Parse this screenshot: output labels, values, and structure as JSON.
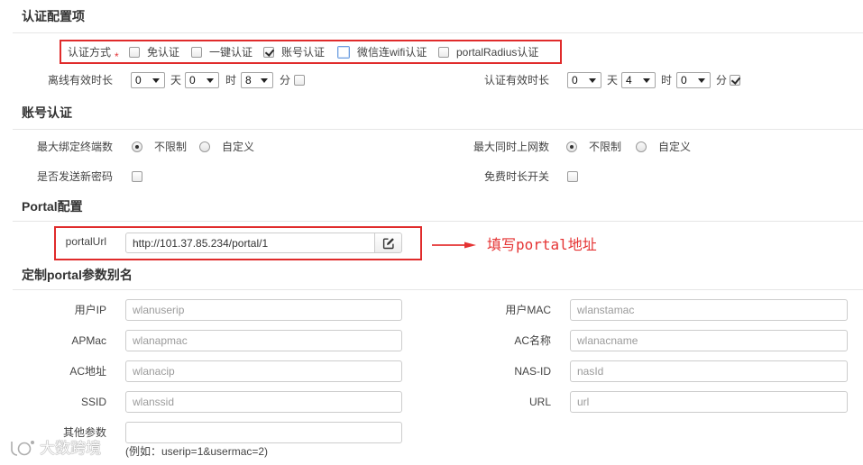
{
  "colors": {
    "highlight_border": "#e02b2b",
    "annotation": "#e53333",
    "required_mark": "#e4393c",
    "focus_outline": "#6f9fe0"
  },
  "auth_config": {
    "title": "认证配置项",
    "auth_method": {
      "label": "认证方式",
      "required_mark": "*",
      "options": [
        {
          "label": "免认证",
          "checked": false
        },
        {
          "label": "一键认证",
          "checked": false
        },
        {
          "label": "账号认证",
          "checked": true
        },
        {
          "label": "微信连wifi认证",
          "checked": false,
          "focused": true
        },
        {
          "label": "portalRadius认证",
          "checked": false
        }
      ]
    },
    "offline_duration": {
      "label": "离线有效时长",
      "days": "0",
      "days_unit": "天",
      "hours": "0",
      "hours_unit": "时",
      "minutes": "8",
      "minutes_unit": "分",
      "enabled": false
    },
    "auth_duration": {
      "label": "认证有效时长",
      "days": "0",
      "days_unit": "天",
      "hours": "4",
      "hours_unit": "时",
      "minutes": "0",
      "minutes_unit": "分",
      "enabled": true
    }
  },
  "account_auth": {
    "title": "账号认证",
    "max_bound_devices": {
      "label": "最大绑定终端数",
      "options": [
        {
          "label": "不限制",
          "selected": true
        },
        {
          "label": "自定义",
          "selected": false
        }
      ]
    },
    "max_concurrent_online": {
      "label": "最大同时上网数",
      "options": [
        {
          "label": "不限制",
          "selected": true
        },
        {
          "label": "自定义",
          "selected": false
        }
      ]
    },
    "send_new_password": {
      "label": "是否发送新密码",
      "checked": false
    },
    "free_duration_switch": {
      "label": "免费时长开关",
      "checked": false
    }
  },
  "portal_config": {
    "title": "Portal配置",
    "portal_url": {
      "label": "portalUrl",
      "value": "http://101.37.85.234/portal/1",
      "button_icon": "edit-icon"
    },
    "annotation": "填写portal地址"
  },
  "portal_params": {
    "title": "定制portal参数别名",
    "left": [
      {
        "label": "用户IP",
        "placeholder": "wlanuserip"
      },
      {
        "label": "APMac",
        "placeholder": "wlanapmac"
      },
      {
        "label": "AC地址",
        "placeholder": "wlanacip"
      },
      {
        "label": "SSID",
        "placeholder": "wlanssid"
      }
    ],
    "right": [
      {
        "label": "用户MAC",
        "placeholder": "wlanstamac"
      },
      {
        "label": "AC名称",
        "placeholder": "wlanacname"
      },
      {
        "label": "NAS-ID",
        "placeholder": "nasId"
      },
      {
        "label": "URL",
        "placeholder": "url"
      }
    ],
    "other_params": {
      "label": "其他参数",
      "hint": "(例如：userip=1&usermac=2)"
    }
  },
  "watermark": {
    "text": "大数跨境",
    "logo_icon": "watermark-logo-icon"
  }
}
